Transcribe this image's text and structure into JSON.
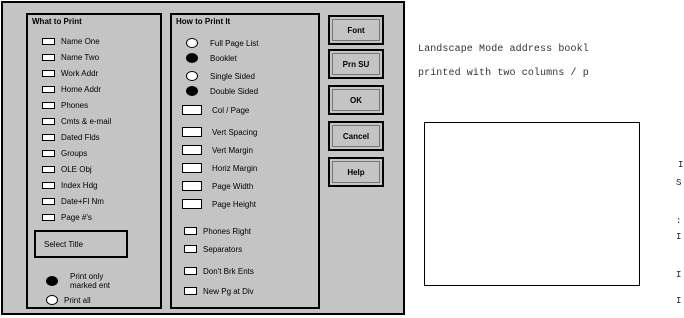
{
  "what_to_print": {
    "title": "What to Print",
    "items": [
      {
        "label": "Name One"
      },
      {
        "label": "Name Two"
      },
      {
        "label": "Work Addr"
      },
      {
        "label": "Home Addr"
      },
      {
        "label": "Phones"
      },
      {
        "label": "Cmts & e-mail"
      },
      {
        "label": "Dated Flds"
      },
      {
        "label": "Groups"
      },
      {
        "label": "OLE Obj"
      },
      {
        "label": "Index Hdg"
      },
      {
        "label": "Date+Fl Nm"
      },
      {
        "label": "Page #'s"
      }
    ],
    "select_title": "Select Title",
    "print_only_marked_line1": "Print only",
    "print_only_marked_line2": "marked ent",
    "print_all": "Print all",
    "selected_scope": "Print only marked ent"
  },
  "how_to_print": {
    "title": "How to Print It",
    "layout_options": [
      {
        "label": "Full Page List",
        "selected": false
      },
      {
        "label": "Booklet",
        "selected": true
      }
    ],
    "sided_options": [
      {
        "label": "Single Sided",
        "selected": false
      },
      {
        "label": "Double Sided",
        "selected": true
      }
    ],
    "fields": [
      {
        "label": "Col / Page",
        "value": ""
      },
      {
        "label": "Vert Spacing",
        "value": ""
      },
      {
        "label": "Vert Margin",
        "value": ""
      },
      {
        "label": "Horiz Margin",
        "value": ""
      },
      {
        "label": "Page Width",
        "value": ""
      },
      {
        "label": "Page Height",
        "value": ""
      }
    ],
    "checkboxes": [
      {
        "label": "Phones Right"
      },
      {
        "label": "Separators"
      },
      {
        "label": "Don't Brk Ents"
      },
      {
        "label": "New Pg at Div"
      }
    ]
  },
  "buttons": {
    "font": "Font",
    "prn_su": "Prn SU",
    "ok": "OK",
    "cancel": "Cancel",
    "help": "Help"
  },
  "description": {
    "line1": "Landscape Mode address bookl",
    "line2": "printed with two columns / p"
  },
  "right_fragments": [
    "I",
    "S",
    ":",
    "I",
    "I",
    "I"
  ]
}
